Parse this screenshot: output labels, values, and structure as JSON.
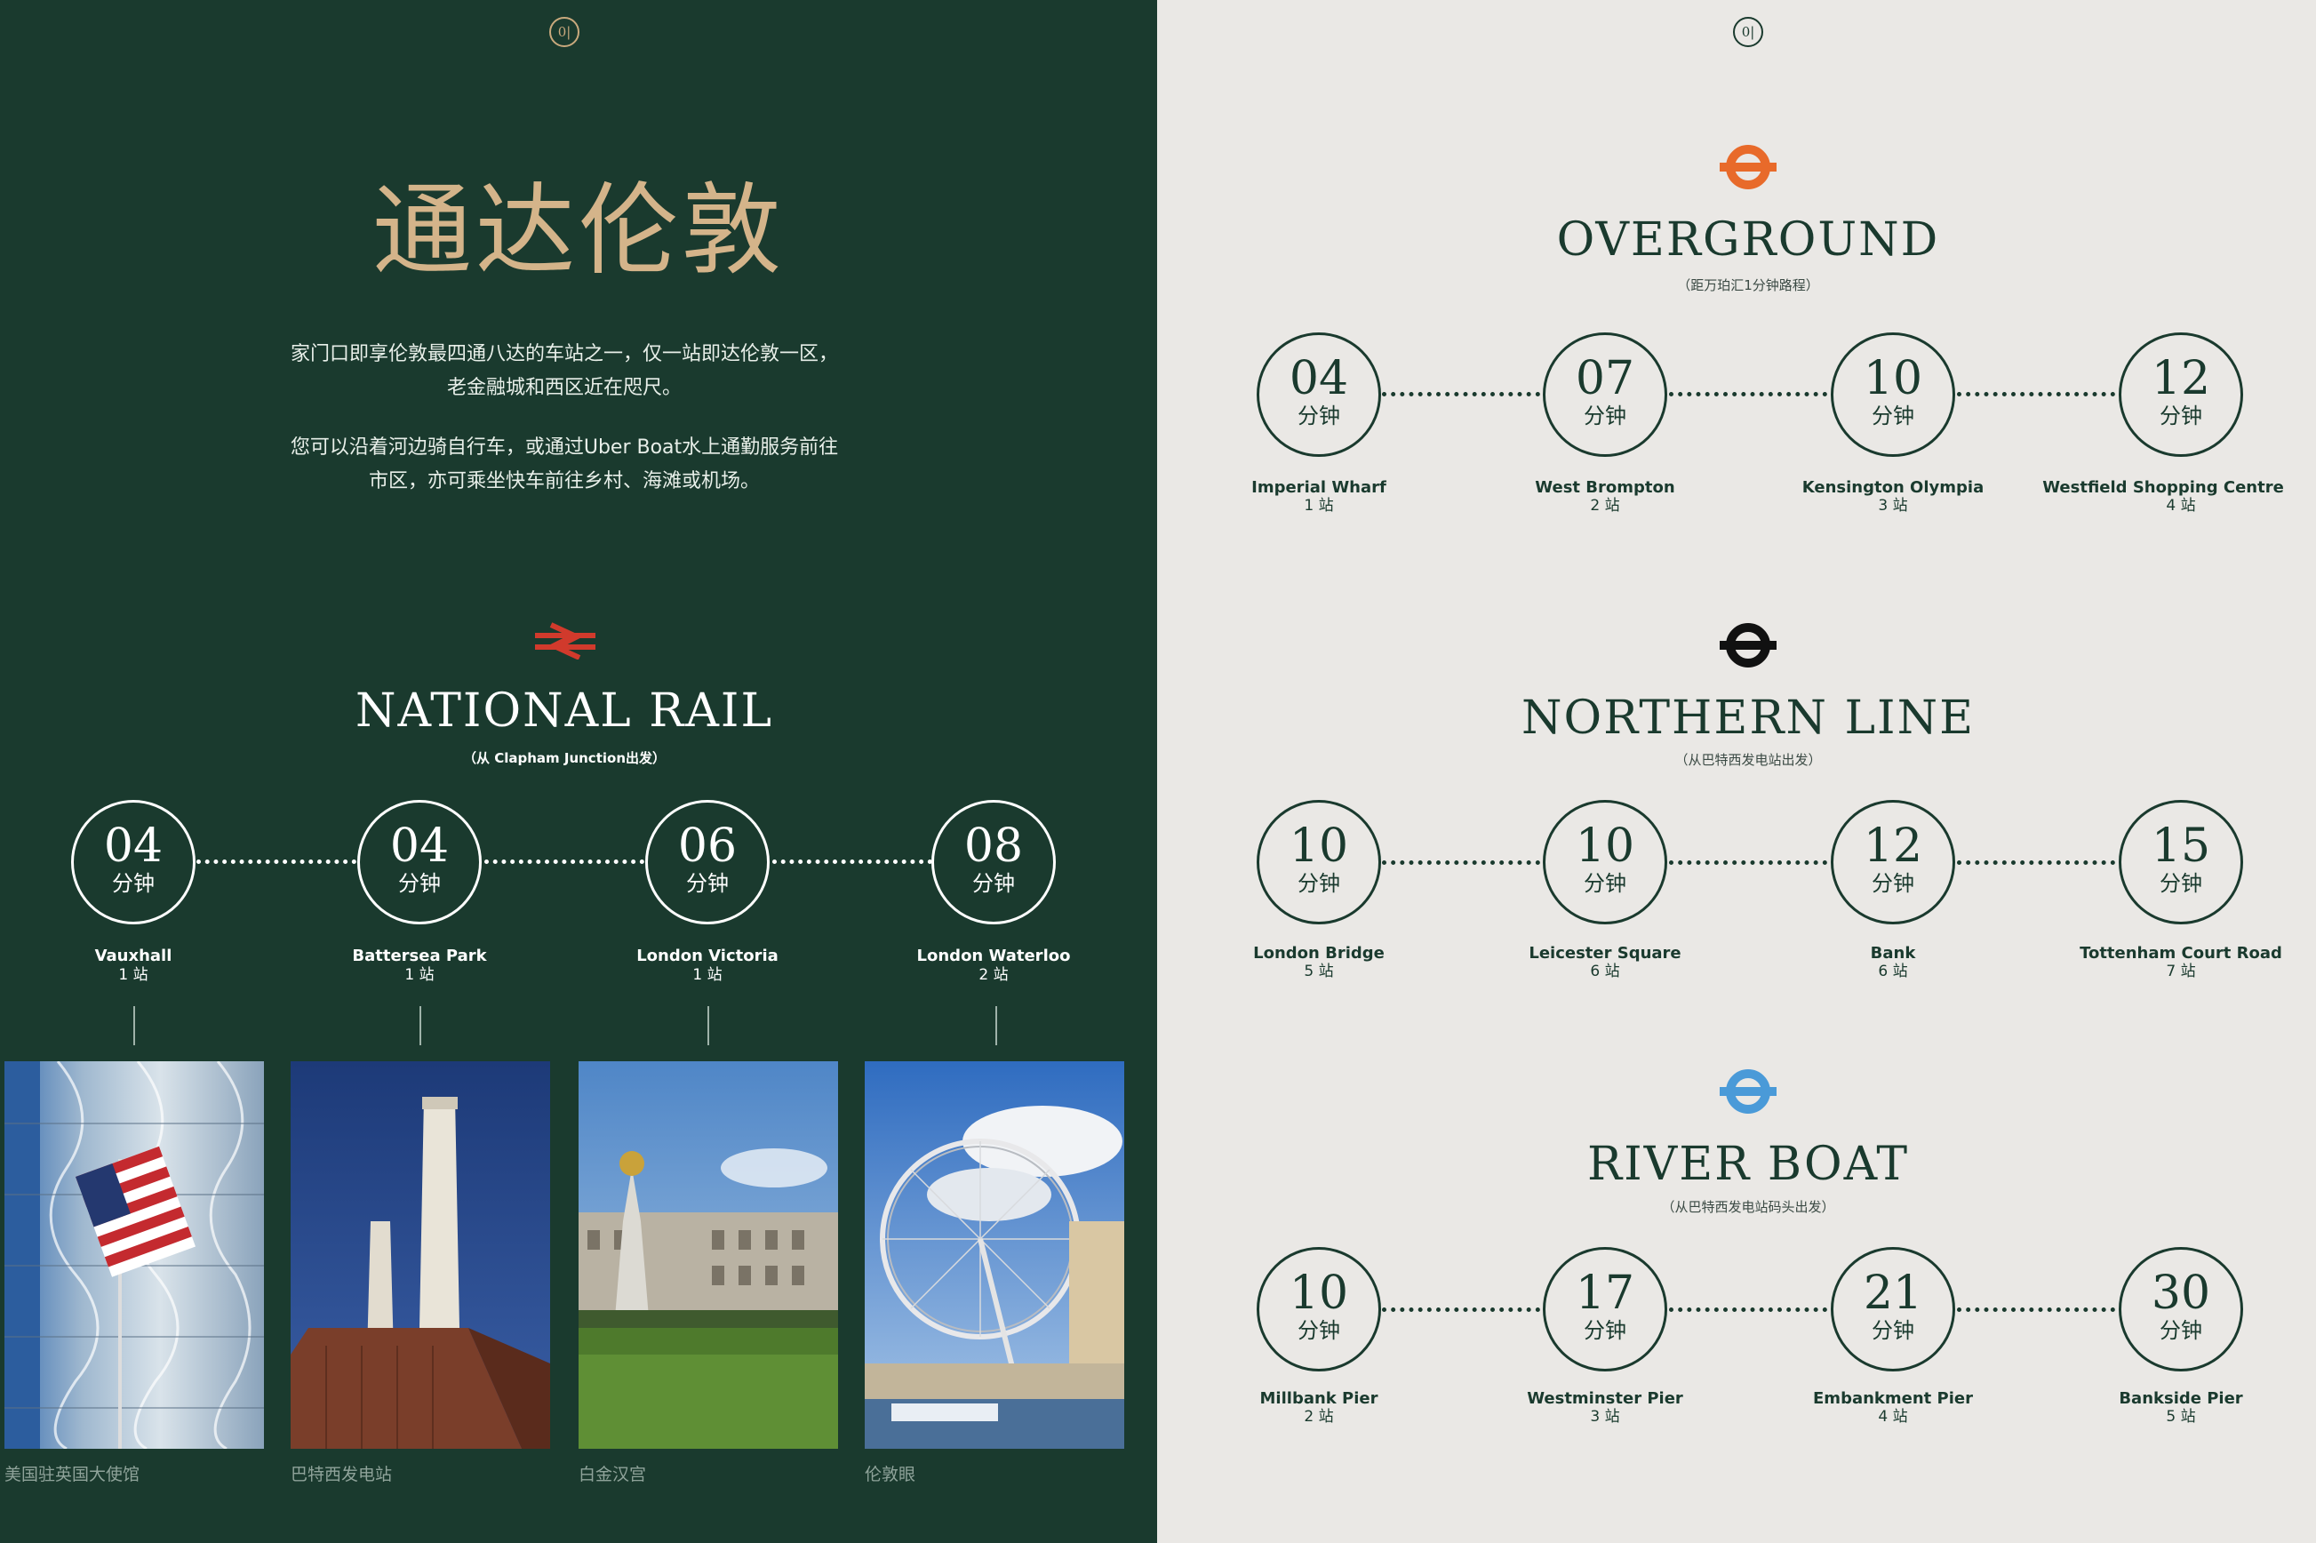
{
  "logo_text": "0|",
  "left": {
    "title": "通达伦敦",
    "intro": [
      [
        "家门口即享伦敦最四通八达的车站之一，仅一站即达伦敦一区，",
        "老金融城和西区近在咫尺。"
      ],
      [
        "您可以沿着河边骑自行车，或通过Uber Boat水上通勤服务前往",
        "市区，亦可乘坐快车前往乡村、海滩或机场。"
      ]
    ],
    "national_rail": {
      "title": "NATIONAL RAIL",
      "subtitle": "（从 Clapham Junction出发）",
      "icon": "national-rail-icon",
      "icon_color": "#d13a2c",
      "stops": [
        {
          "minutes": "04",
          "unit": "分钟",
          "name": "Vauxhall",
          "count": "1 站"
        },
        {
          "minutes": "04",
          "unit": "分钟",
          "name": "Battersea Park",
          "count": "1 站"
        },
        {
          "minutes": "06",
          "unit": "分钟",
          "name": "London Victoria",
          "count": "1 站"
        },
        {
          "minutes": "08",
          "unit": "分钟",
          "name": "London Waterloo",
          "count": "2 站"
        }
      ]
    },
    "photos": [
      {
        "caption": "美国驻英国大使馆"
      },
      {
        "caption": "巴特西发电站"
      },
      {
        "caption": "白金汉宫"
      },
      {
        "caption": "伦敦眼"
      }
    ]
  },
  "right": {
    "overground": {
      "title": "OVERGROUND",
      "subtitle": "（距万珀汇1分钟路程）",
      "icon": "overground-roundel-icon",
      "icon_color": "#e86a2a",
      "stops": [
        {
          "minutes": "04",
          "unit": "分钟",
          "name": "Imperial Wharf",
          "count": "1 站"
        },
        {
          "minutes": "07",
          "unit": "分钟",
          "name": "West Brompton",
          "count": "2 站"
        },
        {
          "minutes": "10",
          "unit": "分钟",
          "name": "Kensington Olympia",
          "count": "3 站"
        },
        {
          "minutes": "12",
          "unit": "分钟",
          "name": "Westfield Shopping Centre",
          "count": "4 站"
        }
      ]
    },
    "northern_line": {
      "title": "NORTHERN LINE",
      "subtitle": "（从巴特西发电站出发）",
      "icon": "underground-roundel-icon",
      "icon_color": "#111111",
      "stops": [
        {
          "minutes": "10",
          "unit": "分钟",
          "name": "London Bridge",
          "count": "5 站"
        },
        {
          "minutes": "10",
          "unit": "分钟",
          "name": "Leicester Square",
          "count": "6 站"
        },
        {
          "minutes": "12",
          "unit": "分钟",
          "name": "Bank",
          "count": "6 站"
        },
        {
          "minutes": "15",
          "unit": "分钟",
          "name": "Tottenham Court Road",
          "count": "7 站"
        }
      ]
    },
    "river_boat": {
      "title": "RIVER BOAT",
      "subtitle": "（从巴特西发电站码头出发）",
      "icon": "river-boat-roundel-icon",
      "icon_color": "#4a9ad8",
      "stops": [
        {
          "minutes": "10",
          "unit": "分钟",
          "name": "Millbank Pier",
          "count": "2 站"
        },
        {
          "minutes": "17",
          "unit": "分钟",
          "name": "Westminster Pier",
          "count": "3 站"
        },
        {
          "minutes": "21",
          "unit": "分钟",
          "name": "Embankment Pier",
          "count": "4 站"
        },
        {
          "minutes": "30",
          "unit": "分钟",
          "name": "Bankside Pier",
          "count": "5 站"
        }
      ]
    }
  }
}
